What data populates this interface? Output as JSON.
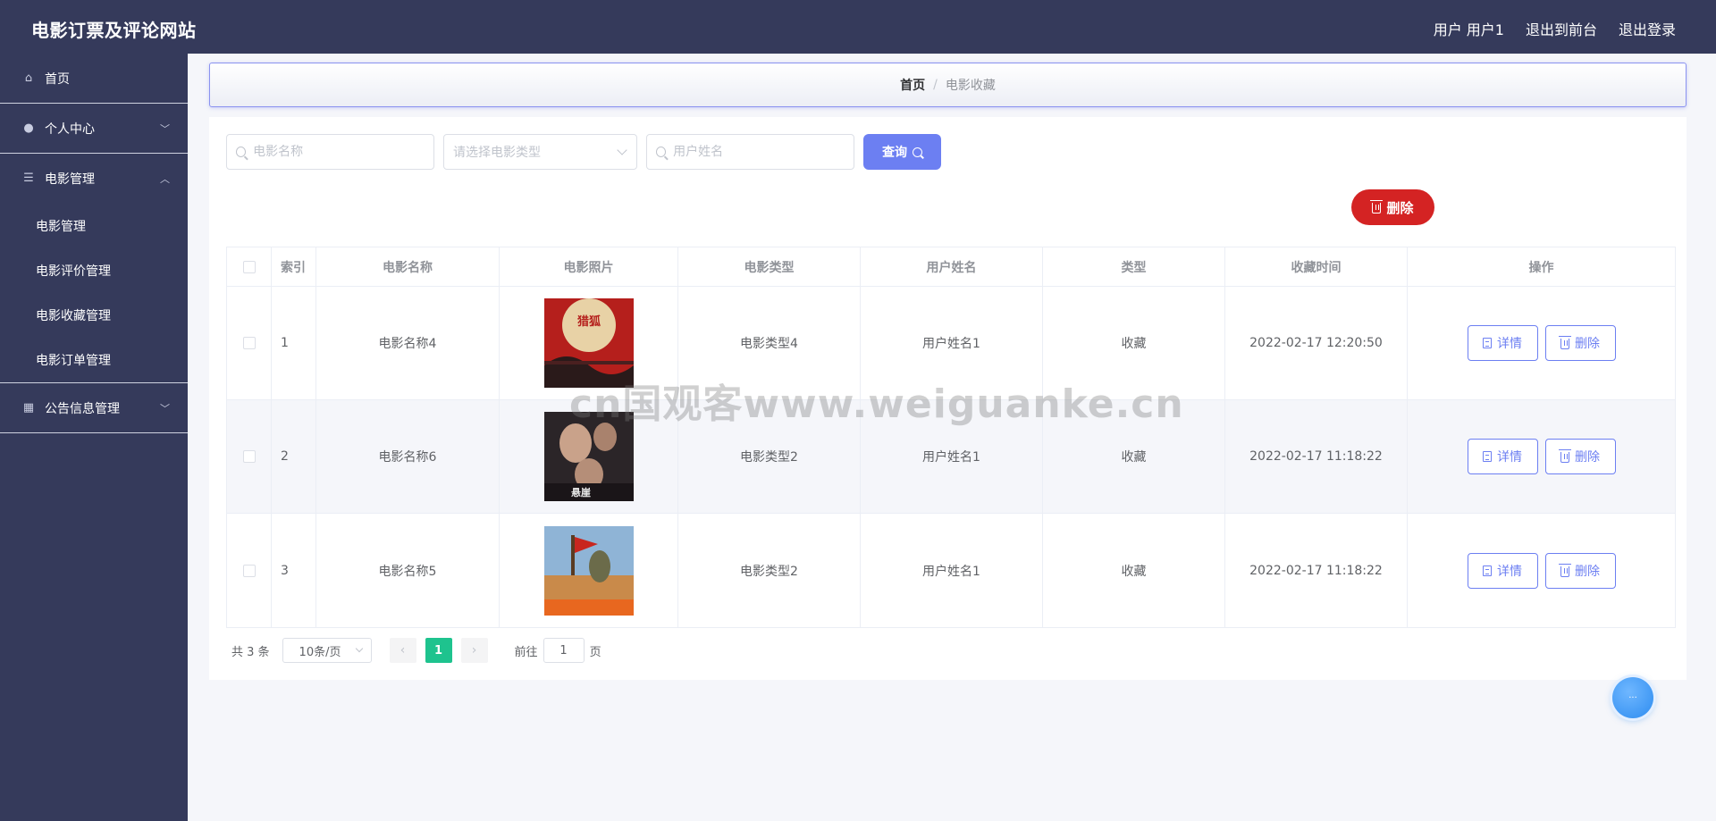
{
  "app": {
    "title": "电影订票及评论网站"
  },
  "header": {
    "user_label": "用户 用户1",
    "front_label": "退出到前台",
    "logout_label": "退出登录"
  },
  "sidebar": {
    "home": "首页",
    "personal": "个人中心",
    "movie_mgmt": "电影管理",
    "sub_items": [
      "电影管理",
      "电影评价管理",
      "电影收藏管理",
      "电影订单管理"
    ],
    "notice": "公告信息管理"
  },
  "breadcrumb": {
    "home": "首页",
    "sep": "/",
    "current": "电影收藏"
  },
  "search": {
    "movie_name_placeholder": "电影名称",
    "movie_type_placeholder": "请选择电影类型",
    "user_name_placeholder": "用户姓名",
    "query_label": "查询"
  },
  "actions": {
    "delete_label": "删除"
  },
  "table": {
    "headers": [
      "索引",
      "电影名称",
      "电影照片",
      "电影类型",
      "用户姓名",
      "类型",
      "收藏时间",
      "操作"
    ],
    "rows": [
      {
        "index": "1",
        "movie_name": "电影名称4",
        "movie_type": "电影类型4",
        "user_name": "用户姓名1",
        "kind": "收藏",
        "time": "2022-02-17 12:20:50",
        "poster": "poster-red-bridge"
      },
      {
        "index": "2",
        "movie_name": "电影名称6",
        "movie_type": "电影类型2",
        "user_name": "用户姓名1",
        "kind": "收藏",
        "time": "2022-02-17 11:18:22",
        "poster": "poster-dark-portraits"
      },
      {
        "index": "3",
        "movie_name": "电影名称5",
        "movie_type": "电影类型2",
        "user_name": "用户姓名1",
        "kind": "收藏",
        "time": "2022-02-17 11:18:22",
        "poster": "poster-soldier-flag"
      }
    ],
    "detail_label": "详情",
    "delete_label": "删除"
  },
  "pagination": {
    "total_text": "共 3 条",
    "page_size": "10条/页",
    "current_page": "1",
    "goto_prefix": "前往",
    "goto_value": "1",
    "goto_suffix": "页"
  },
  "watermark": "cn国观客www.weiguanke.cn",
  "colors": {
    "sidebar": "#353a5b",
    "accent": "#6c7ff2",
    "danger": "#d42323",
    "page_active": "#1ec38e"
  }
}
